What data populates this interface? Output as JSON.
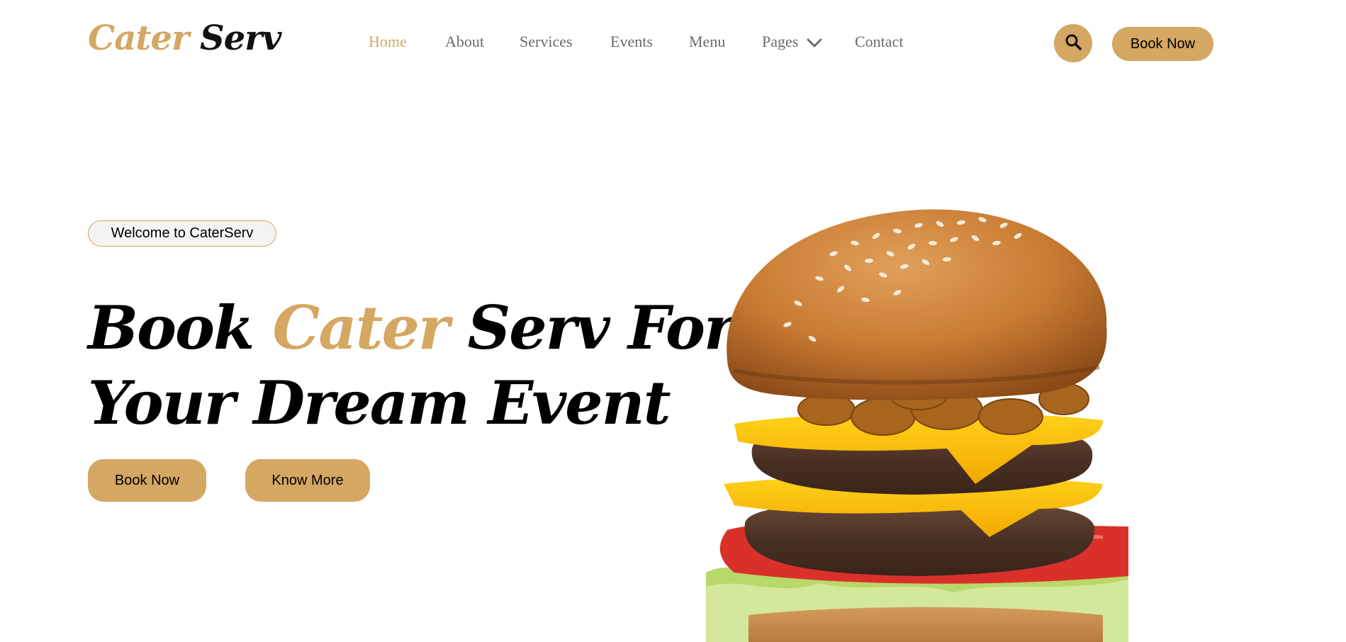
{
  "brand": {
    "part1": "Cater",
    "part2": "Serv"
  },
  "nav": {
    "items": [
      {
        "label": "Home",
        "active": true
      },
      {
        "label": "About"
      },
      {
        "label": "Services"
      },
      {
        "label": "Events"
      },
      {
        "label": "Menu"
      },
      {
        "label": "Pages",
        "has_dropdown": true
      },
      {
        "label": "Contact"
      }
    ]
  },
  "header": {
    "search_icon": "search-icon",
    "book_label": "Book Now"
  },
  "hero": {
    "badge": "Welcome to CaterServ",
    "title": {
      "word1": "Book",
      "accent": "Cater",
      "word2": "Serv For",
      "line2": "Your Dream Event"
    },
    "primary_button": "Book Now",
    "secondary_button": "Know More",
    "image": "burger-image"
  },
  "colors": {
    "accent": "#d4a762",
    "nav_text": "#6b6b6b",
    "text": "#000000"
  }
}
